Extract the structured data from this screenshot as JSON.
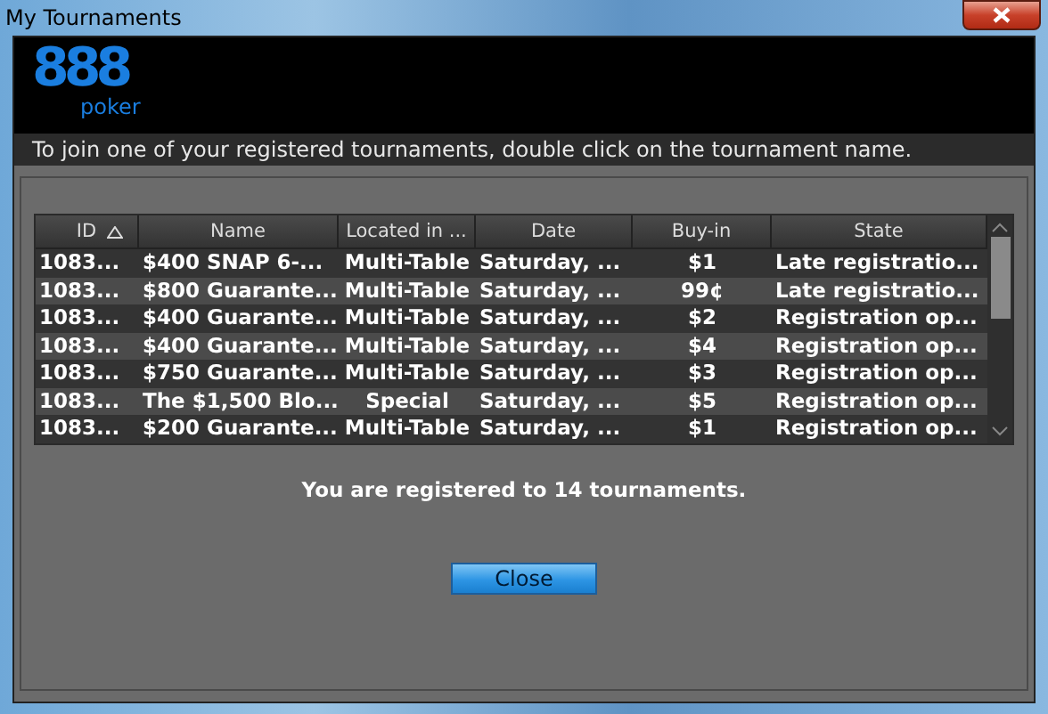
{
  "window": {
    "title": "My Tournaments"
  },
  "logo": {
    "mark": "888",
    "word": "poker"
  },
  "instruction": "To join one of your registered tournaments, double click on the tournament name.",
  "table": {
    "columns": [
      {
        "label": "ID",
        "sorted": true
      },
      {
        "label": "Name",
        "sorted": false
      },
      {
        "label": "Located in ...",
        "sorted": false
      },
      {
        "label": "Date",
        "sorted": false
      },
      {
        "label": "Buy-in",
        "sorted": false
      },
      {
        "label": "State",
        "sorted": false
      }
    ],
    "rows": [
      [
        "1083...",
        "$400 SNAP 6-...",
        "Multi-Table",
        "Saturday, ...",
        "$1",
        "Late registratio..."
      ],
      [
        "1083...",
        "$800 Guarante...",
        "Multi-Table",
        "Saturday, ...",
        "99¢",
        "Late registratio..."
      ],
      [
        "1083...",
        "$400 Guarante...",
        "Multi-Table",
        "Saturday, ...",
        "$2",
        "Registration op..."
      ],
      [
        "1083...",
        "$400 Guarante...",
        "Multi-Table",
        "Saturday, ...",
        "$4",
        "Registration op..."
      ],
      [
        "1083...",
        "$750 Guarante...",
        "Multi-Table",
        "Saturday, ...",
        "$3",
        "Registration op..."
      ],
      [
        "1083...",
        "The $1,500 Blo...",
        "Special",
        "Saturday, ...",
        "$5",
        "Registration op..."
      ],
      [
        "1083...",
        "$200 Guarante...",
        "Multi-Table",
        "Saturday, ...",
        "$1",
        "Registration op..."
      ]
    ]
  },
  "summary": "You are registered to 14 tournaments.",
  "buttons": [
    {
      "label": "Close"
    }
  ]
}
